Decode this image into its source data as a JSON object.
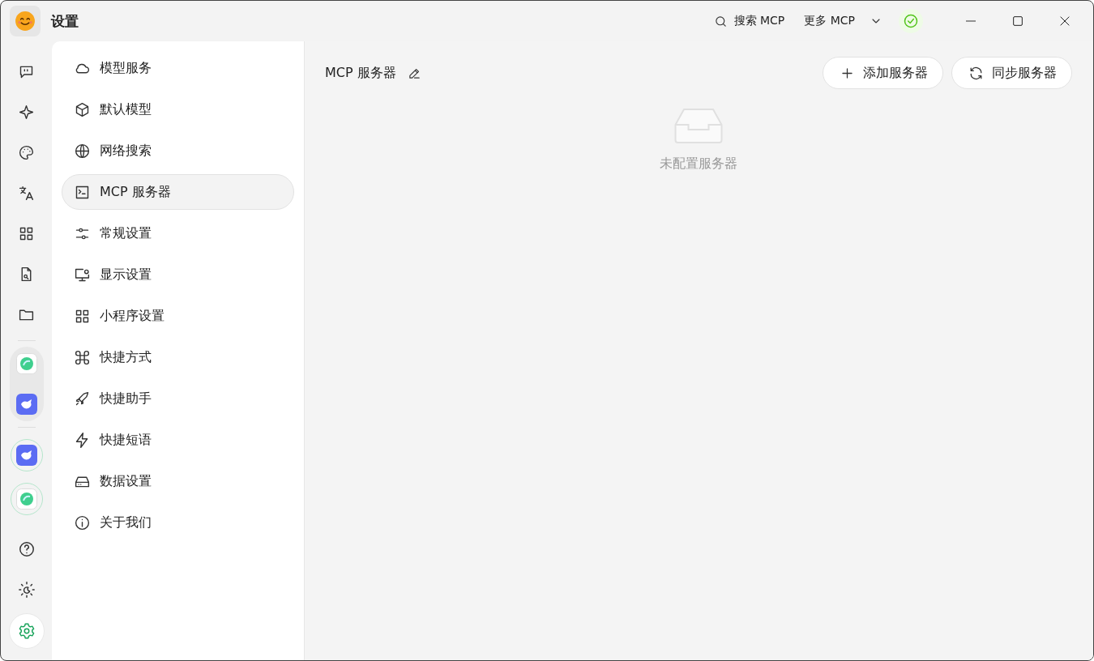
{
  "window": {
    "title": "设置"
  },
  "topbar": {
    "search_label": "搜索 MCP",
    "more_label": "更多 MCP"
  },
  "rail": {
    "top": [
      {
        "selected": false
      },
      {
        "selected": false
      },
      {
        "selected": false
      },
      {
        "selected": false
      },
      {
        "selected": false
      },
      {
        "selected": false
      },
      {
        "selected": false
      }
    ],
    "pinned_apps": [
      {
        "kind": "orb"
      },
      {
        "kind": "whale"
      }
    ],
    "open_apps": [
      {
        "kind": "whale"
      },
      {
        "kind": "orb"
      }
    ],
    "bottom": [
      {
        "selected": false
      },
      {
        "selected": false
      },
      {
        "selected": true
      }
    ]
  },
  "menu": [
    {
      "label": "模型服务",
      "selected": false
    },
    {
      "label": "默认模型",
      "selected": false
    },
    {
      "label": "网络搜索",
      "selected": false
    },
    {
      "label": "MCP 服务器",
      "selected": true
    },
    {
      "label": "常规设置",
      "selected": false
    },
    {
      "label": "显示设置",
      "selected": false
    },
    {
      "label": "小程序设置",
      "selected": false
    },
    {
      "label": "快捷方式",
      "selected": false
    },
    {
      "label": "快捷助手",
      "selected": false
    },
    {
      "label": "快捷短语",
      "selected": false
    },
    {
      "label": "数据设置",
      "selected": false
    },
    {
      "label": "关于我们",
      "selected": false
    }
  ],
  "content": {
    "title": "MCP 服务器",
    "buttons": [
      "添加服务器",
      "同步服务器"
    ],
    "empty_text": "未配置服务器"
  }
}
